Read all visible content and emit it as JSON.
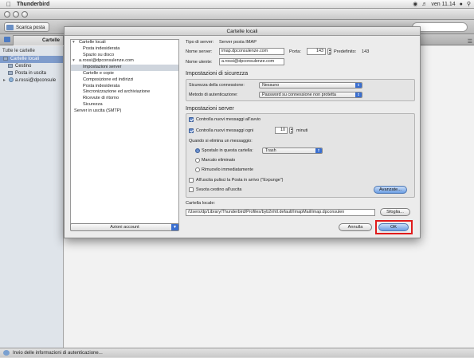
{
  "menubar": {
    "app_name": "Thunderbird",
    "clock": "ven 11.14"
  },
  "toolbar": {
    "get_mail_label": "Scarica posta"
  },
  "tab": {
    "label": "Cartelle"
  },
  "sidebar": {
    "header": "Tutte le cartelle",
    "items": [
      {
        "label": "Cartelle locali"
      },
      {
        "label": "Cestino"
      },
      {
        "label": "Posta in uscita"
      },
      {
        "label": "a.rossi@dpconsule"
      }
    ]
  },
  "statusbar": {
    "text": "Invio delle informazioni di autenticazione..."
  },
  "dialog": {
    "title": "Cartelle locali",
    "tree": [
      {
        "label": "Cartelle locali"
      },
      {
        "label": "Posta indesiderata"
      },
      {
        "label": "Spazio su disco"
      },
      {
        "label": "a.rossi@dpconsulenze.com"
      },
      {
        "label": "Impostazioni server"
      },
      {
        "label": "Cartelle e copie"
      },
      {
        "label": "Composizione ed indirizzi"
      },
      {
        "label": "Posta indesiderata"
      },
      {
        "label": "Sincronizzazione ed archiviazione"
      },
      {
        "label": "Ricevute di ritorno"
      },
      {
        "label": "Sicurezza"
      },
      {
        "label": "Server in uscita (SMTP)"
      }
    ],
    "account_actions_label": "Azioni account",
    "server_type_label": "Tipo di server:",
    "server_type_value": "Server posta IMAP",
    "server_name_label": "Nome server:",
    "server_name_value": "imap.dpconsulenze.com",
    "port_label": "Porta:",
    "port_value": "143",
    "default_label": "Predefinito:",
    "default_value": "143",
    "username_label": "Nome utente:",
    "username_value": "a.rossi@dpconsulenze.com",
    "security": {
      "title": "Impostazioni di sicurezza",
      "connection_label": "Sicurezza della connessione:",
      "connection_value": "Nessuno",
      "auth_label": "Metodo di autenticazione:",
      "auth_value": "Password su connessione non protetta"
    },
    "server_settings": {
      "title": "Impostazioni server",
      "check_startup_label": "Controlla nuovi messaggi all'avvio",
      "check_every_label": "Controlla nuovi messaggi ogni",
      "check_every_value": "10",
      "minutes_label": "minuti",
      "on_delete_label": "Quando si elimina un messaggio:",
      "move_to_label": "Spostalo in questa cartella:",
      "move_to_value": "Trash",
      "mark_deleted_label": "Marcalo eliminato",
      "remove_now_label": "Rimuovilo immediatamente",
      "expunge_label": "All'uscita pulisci la Posta in arrivo (\"Expunge\")",
      "empty_trash_label": "Svuota cestino all'uscita",
      "advanced_label": "Avanzate..."
    },
    "local_dir_label": "Cartella locale:",
    "local_dir_value": "/Users/dp/Library/Thunderbird/Profiles/byb2nhtl.default/ImapMail/imap.dpconsulen",
    "browse_label": "Sfoglia...",
    "cancel_label": "Annulla",
    "ok_label": "OK"
  }
}
